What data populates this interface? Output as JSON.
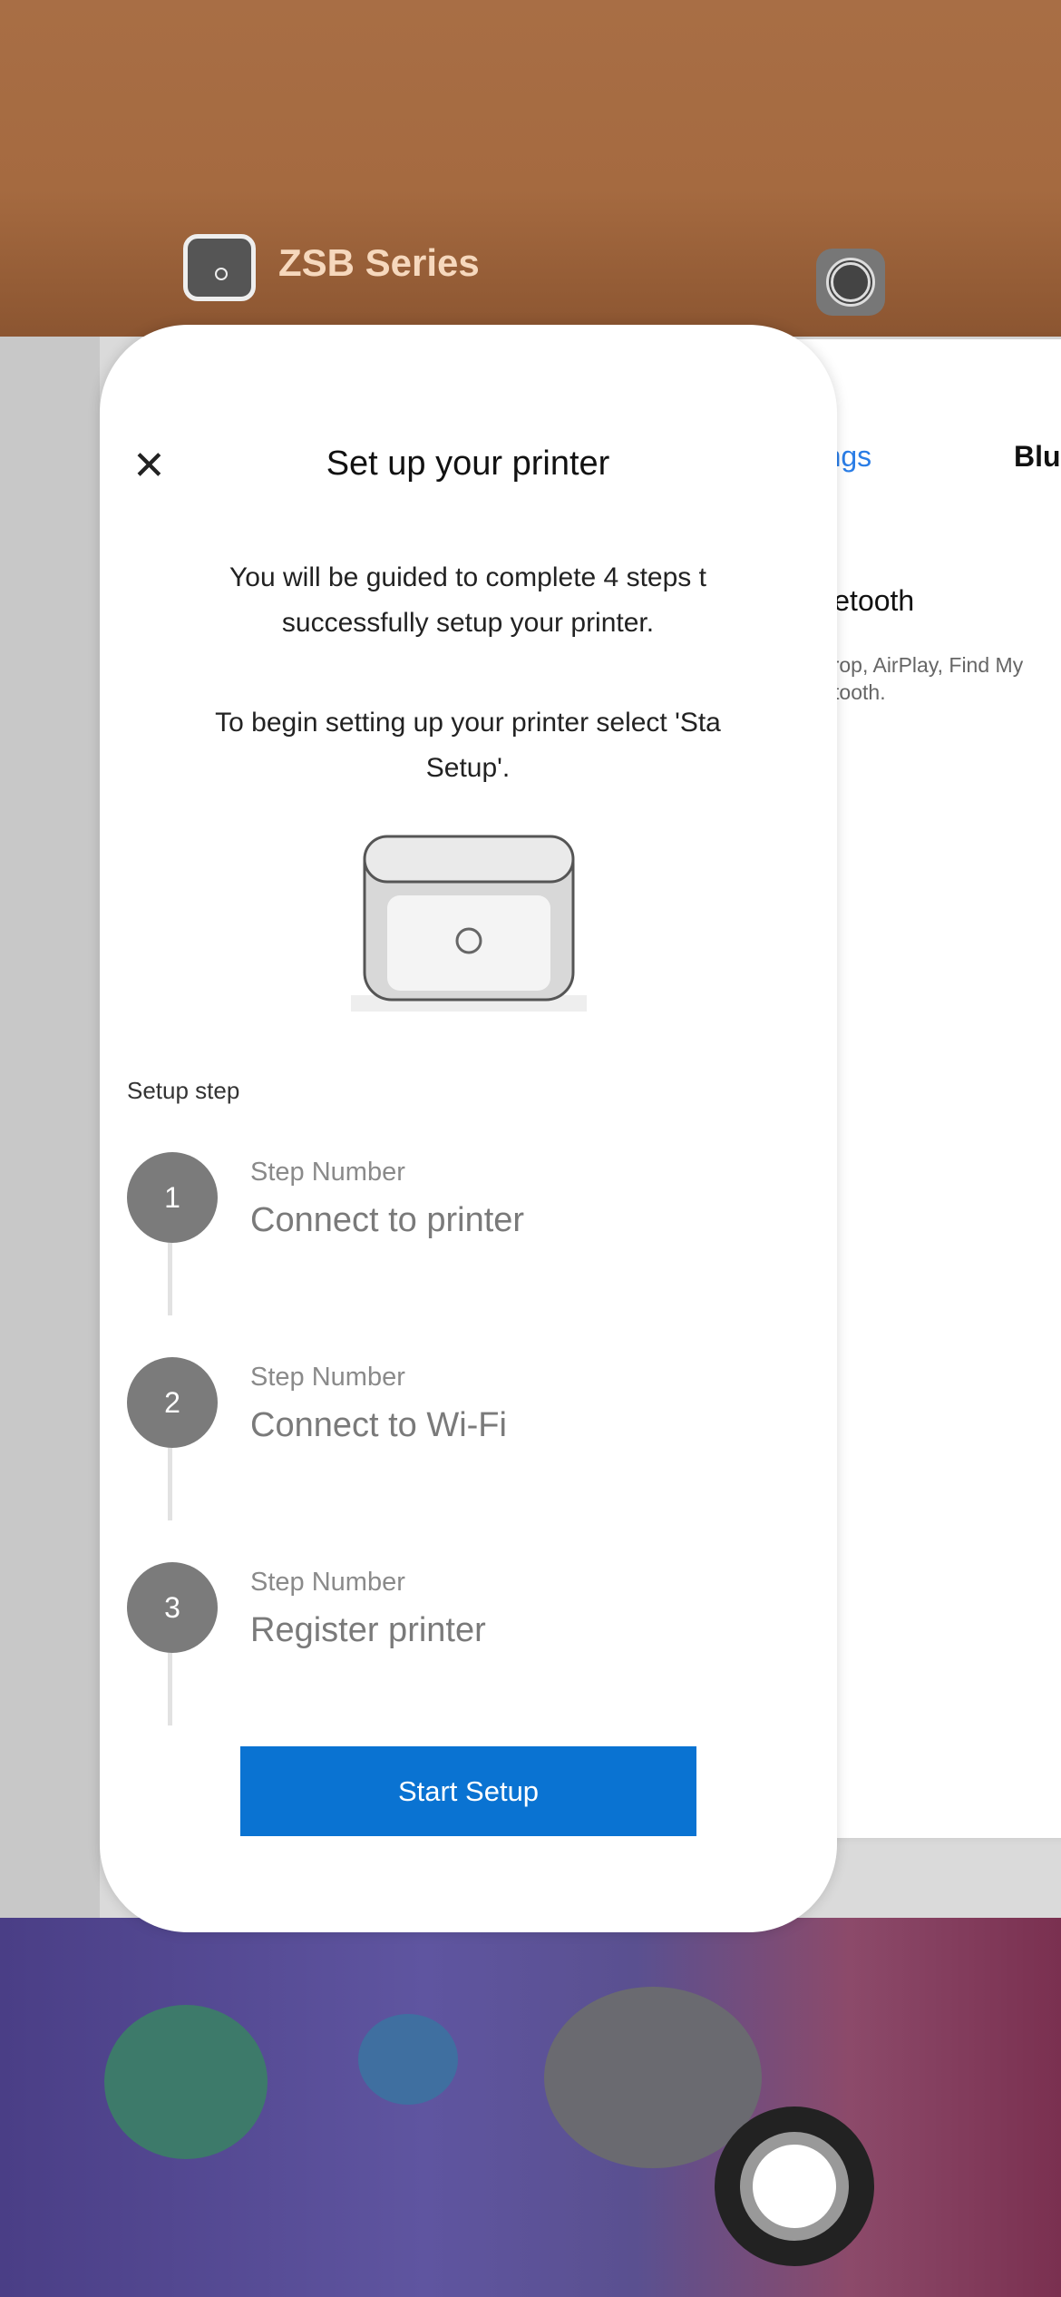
{
  "switcher": {
    "app_name": "ZSB Series"
  },
  "main_card": {
    "title": "Set up your printer",
    "body_line1": "You will be guided to complete 4 steps t",
    "body_line2": "successfully setup your printer.",
    "body_line3": "To begin setting up your printer select 'Sta",
    "body_line4": "Setup'.",
    "setup_label": "Setup step",
    "steps": [
      {
        "number": "1",
        "caption": "Step Number",
        "title": "Connect to printer"
      },
      {
        "number": "2",
        "caption": "Step Number",
        "title": "Connect to Wi-Fi"
      },
      {
        "number": "3",
        "caption": "Step Number",
        "title": "Register printer"
      }
    ],
    "start_button": "Start Setup"
  },
  "settings_card": {
    "back_label": "Settings",
    "title": "Blu",
    "row_label": "Bluetooth",
    "description": "AirDrop, AirPlay, Find My",
    "description_line2": "Bluetooth."
  },
  "colors": {
    "accent": "#0a73d2",
    "link": "#2a7de6"
  }
}
